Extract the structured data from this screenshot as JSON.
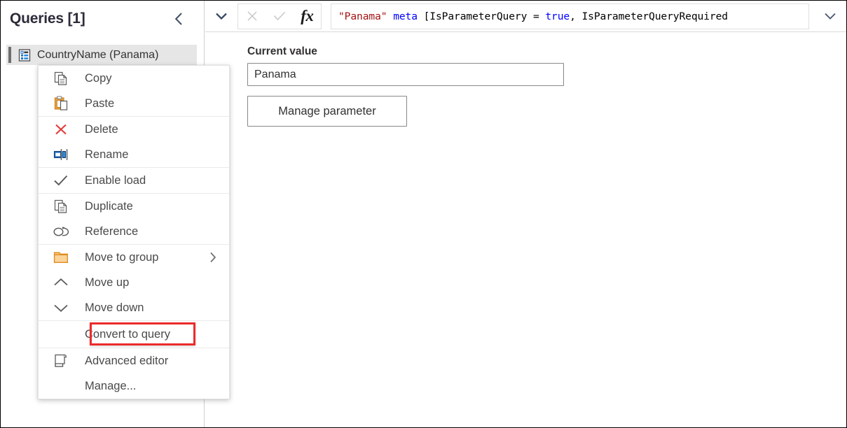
{
  "queries_pane": {
    "title": "Queries [1]",
    "collapse_icon": "chevron-left-icon",
    "item": {
      "label": "CountryName (Panama)",
      "icon": "parameter-icon"
    }
  },
  "context_menu": {
    "sections": [
      {
        "items": [
          {
            "label": "Copy",
            "icon": "copy-icon"
          },
          {
            "label": "Paste",
            "icon": "paste-icon"
          }
        ]
      },
      {
        "items": [
          {
            "label": "Delete",
            "icon": "delete-x-icon"
          },
          {
            "label": "Rename",
            "icon": "rename-icon"
          }
        ]
      },
      {
        "items": [
          {
            "label": "Enable load",
            "icon": "check-icon"
          }
        ]
      },
      {
        "items": [
          {
            "label": "Duplicate",
            "icon": "duplicate-icon"
          },
          {
            "label": "Reference",
            "icon": "reference-link-icon"
          }
        ]
      },
      {
        "items": [
          {
            "label": "Move to group",
            "icon": "folder-icon",
            "submenu_icon": "chevron-right-icon"
          },
          {
            "label": "Move up",
            "icon": "chevron-up-icon"
          },
          {
            "label": "Move down",
            "icon": "chevron-down-icon"
          }
        ]
      },
      {
        "items": [
          {
            "label": "Convert to query",
            "icon": "",
            "highlighted": true
          }
        ]
      },
      {
        "items": [
          {
            "label": "Advanced editor",
            "icon": "advanced-editor-icon"
          },
          {
            "label": "Manage...",
            "icon": ""
          }
        ]
      }
    ]
  },
  "formula_bar": {
    "expand_icon": "chevron-down-icon",
    "cancel_icon": "close-x-icon",
    "confirm_icon": "checkmark-icon",
    "fx_icon": "fx-icon",
    "dropdown_icon": "chevron-down-icon",
    "formula_tokens": [
      {
        "text": "\"Panama\"",
        "type": "str"
      },
      {
        "text": " ",
        "type": "pln"
      },
      {
        "text": "meta",
        "type": "kw"
      },
      {
        "text": " [IsParameterQuery = ",
        "type": "pln"
      },
      {
        "text": "true",
        "type": "kw"
      },
      {
        "text": ", IsParameterQueryRequired",
        "type": "pln"
      }
    ],
    "formula_text": "\"Panama\" meta [IsParameterQuery = true, IsParameterQueryRequired"
  },
  "parameter_panel": {
    "current_value_label": "Current value",
    "current_value": "Panama",
    "current_value_placeholder": "",
    "manage_parameter_label": "Manage parameter"
  },
  "colors": {
    "accent_orange": "#e8a33d",
    "delete_red": "#e23b3b",
    "highlight_red": "#ec2b2b",
    "chevron_navy": "#2b3a55",
    "selection_gray": "#e6e6e6",
    "string_red": "#a31515",
    "keyword_blue": "#0000ff"
  }
}
